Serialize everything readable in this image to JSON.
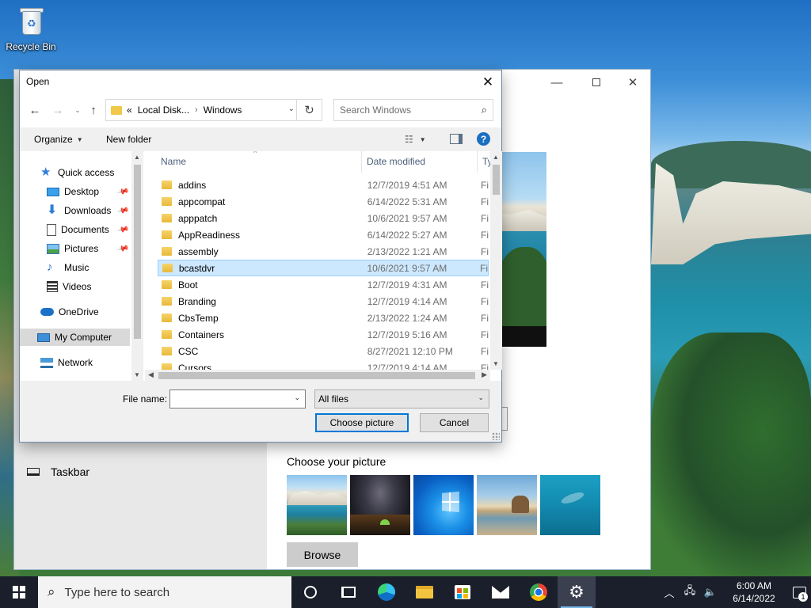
{
  "desktop": {
    "recycle_bin_label": "Recycle Bin"
  },
  "settings_window": {
    "sidebar_item": "Taskbar",
    "choose_picture_title": "Choose your picture",
    "browse_label": "Browse",
    "thumbnails": [
      "cliffs",
      "night-sky-tent",
      "windows-hero",
      "beach-rock",
      "underwater-swimmer"
    ]
  },
  "dialog": {
    "title": "Open",
    "address": {
      "overflow": "«",
      "crumbs": [
        "Local Disk...",
        "Windows"
      ]
    },
    "search_placeholder": "Search Windows",
    "toolbar": {
      "organize": "Organize",
      "new_folder": "New folder",
      "help": "?"
    },
    "nav": {
      "quick_access": "Quick access",
      "desktop": "Desktop",
      "downloads": "Downloads",
      "documents": "Documents",
      "pictures": "Pictures",
      "music": "Music",
      "videos": "Videos",
      "onedrive": "OneDrive",
      "my_computer": "My Computer",
      "network": "Network"
    },
    "columns": {
      "name": "Name",
      "date": "Date modified",
      "type": "Ty"
    },
    "files": [
      {
        "name": "addins",
        "date": "12/7/2019 4:51 AM",
        "type": "Fi"
      },
      {
        "name": "appcompat",
        "date": "6/14/2022 5:31 AM",
        "type": "Fi"
      },
      {
        "name": "apppatch",
        "date": "10/6/2021 9:57 AM",
        "type": "Fi"
      },
      {
        "name": "AppReadiness",
        "date": "6/14/2022 5:27 AM",
        "type": "Fi"
      },
      {
        "name": "assembly",
        "date": "2/13/2022 1:21 AM",
        "type": "Fi"
      },
      {
        "name": "bcastdvr",
        "date": "10/6/2021 9:57 AM",
        "type": "Fi"
      },
      {
        "name": "Boot",
        "date": "12/7/2019 4:31 AM",
        "type": "Fi"
      },
      {
        "name": "Branding",
        "date": "12/7/2019 4:14 AM",
        "type": "Fi"
      },
      {
        "name": "CbsTemp",
        "date": "2/13/2022 1:24 AM",
        "type": "Fi"
      },
      {
        "name": "Containers",
        "date": "12/7/2019 5:16 AM",
        "type": "Fi"
      },
      {
        "name": "CSC",
        "date": "8/27/2021 12:10 PM",
        "type": "Fi"
      },
      {
        "name": "Cursors",
        "date": "12/7/2019 4:14 AM",
        "type": "Fi"
      }
    ],
    "selected_file": "bcastdvr",
    "file_name_label": "File name:",
    "file_name_value": "",
    "filter_value": "All files",
    "open_button": "Choose picture",
    "cancel_button": "Cancel"
  },
  "taskbar": {
    "search_placeholder": "Type here to search",
    "time": "6:00 AM",
    "date": "6/14/2022",
    "notification_count": "1"
  }
}
